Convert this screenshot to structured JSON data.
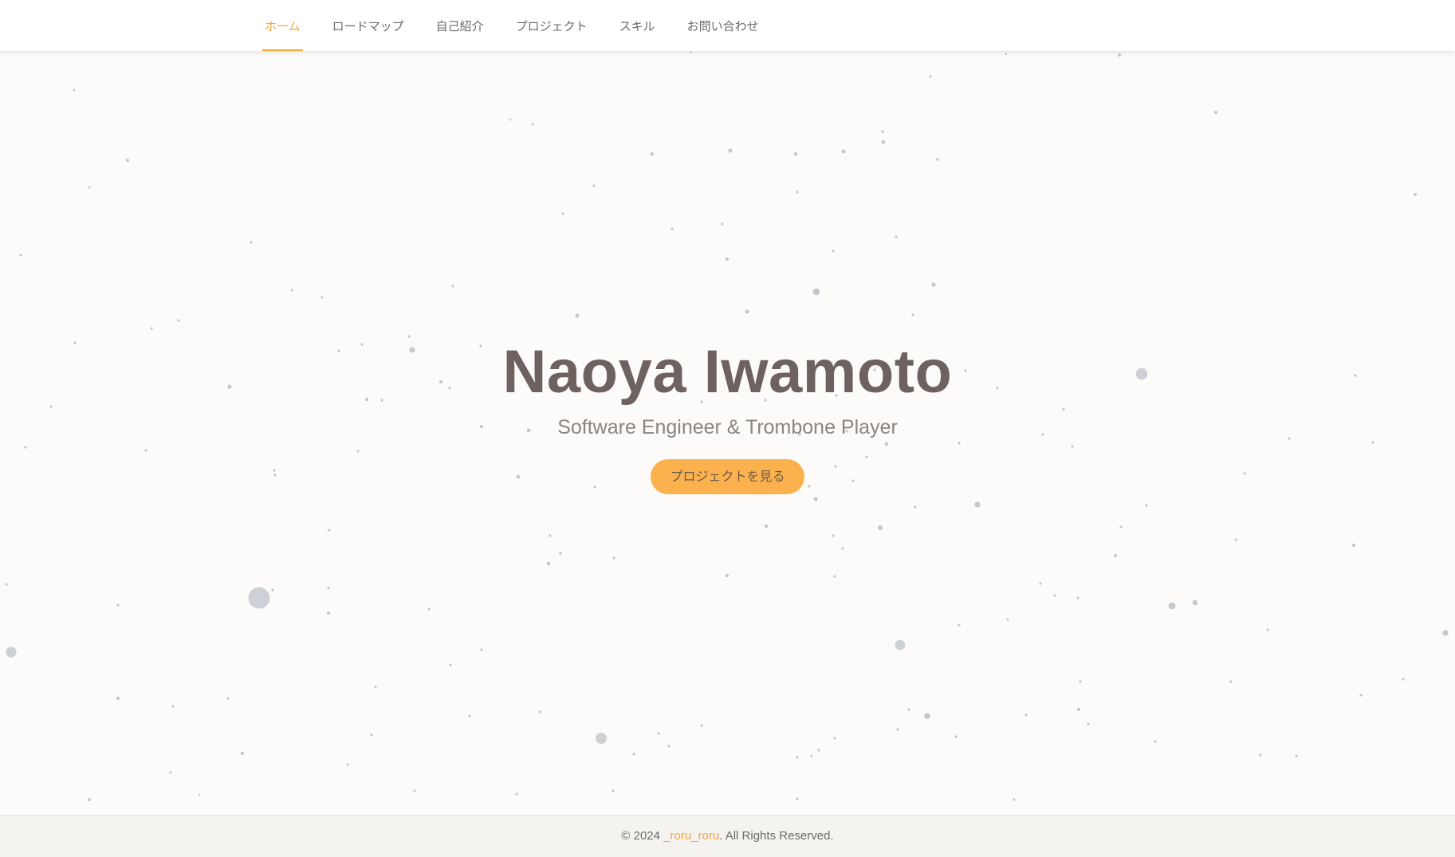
{
  "nav": {
    "items": [
      {
        "label": "ホーム",
        "active": true
      },
      {
        "label": "ロードマップ",
        "active": false
      },
      {
        "label": "自己紹介",
        "active": false
      },
      {
        "label": "プロジェクト",
        "active": false
      },
      {
        "label": "スキル",
        "active": false
      },
      {
        "label": "お問い合わせ",
        "active": false
      }
    ]
  },
  "hero": {
    "title": "Naoya Iwamoto",
    "subtitle": "Software Engineer & Trombone Player",
    "cta_label": "プロジェクトを見る"
  },
  "footer": {
    "copyright_prefix": "© 2024 ",
    "author_link": "_roru_roru",
    "copyright_suffix": ". All Rights Reserved."
  },
  "colors": {
    "accent": "#f2a73b",
    "button": "#fbb24e",
    "title": "#6d6260",
    "particle": "#b8bec3"
  }
}
